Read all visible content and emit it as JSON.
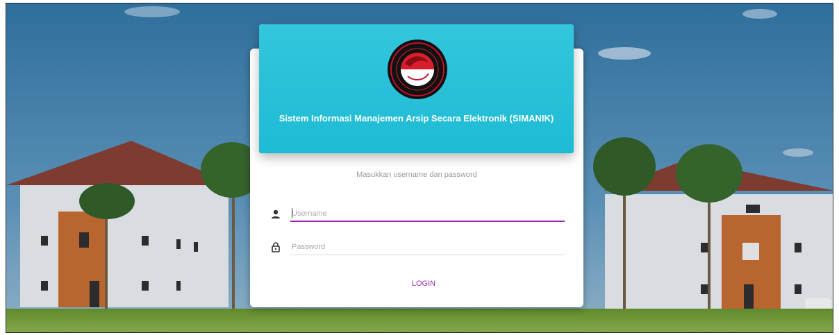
{
  "header": {
    "title": "Sistem Informasi Manajemen Arsip Secara Elektronik (SIMANIK)"
  },
  "logo": {
    "icon": "police-emblem-icon"
  },
  "login": {
    "instruction": "Masukkan username dan password",
    "username_placeholder": "Username",
    "password_placeholder": "Password",
    "login_label": "LOGIN"
  },
  "colors": {
    "header": "#1ebbd4",
    "accent": "#9c27b0",
    "card": "#ffffff"
  }
}
